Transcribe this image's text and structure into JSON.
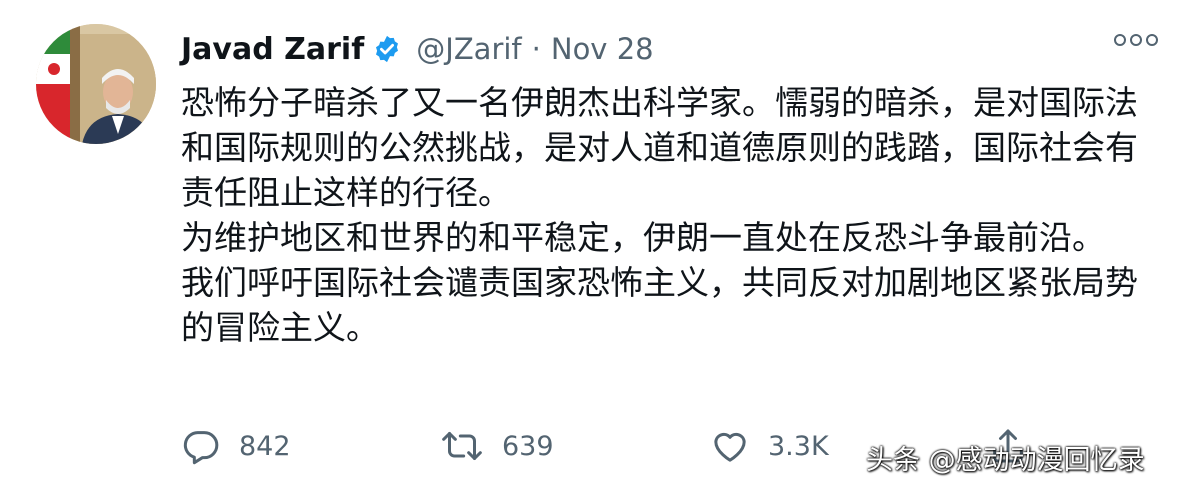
{
  "tweet": {
    "author_name": "Javad Zarif",
    "handle": "@JZarif",
    "separator": "·",
    "date": "Nov 28",
    "paragraphs": [
      "恐怖分子暗杀了又一名伊朗杰出科学家。懦弱的暗杀，是对国际法和国际规则的公然挑战，是对人道和道德原则的践踏，国际社会有责任阻止这样的行径。",
      "为维护地区和世界的和平稳定，伊朗一直处在反恐斗争最前沿。",
      "我们呼吁国际社会谴责国家恐怖主义，共同反对加剧地区紧张局势的冒险主义。"
    ]
  },
  "actions": {
    "reply_count": "842",
    "retweet_count": "639",
    "like_count": "3.3K"
  },
  "watermark": "头条 @感动动漫回忆录",
  "icons": {
    "verified": "verified-badge-icon",
    "more": "more-options-icon",
    "reply": "reply-icon",
    "retweet": "retweet-icon",
    "like": "like-icon",
    "share": "share-icon"
  },
  "colors": {
    "text": "#0f1419",
    "secondary": "#536471",
    "verified": "#1d9bf0"
  }
}
